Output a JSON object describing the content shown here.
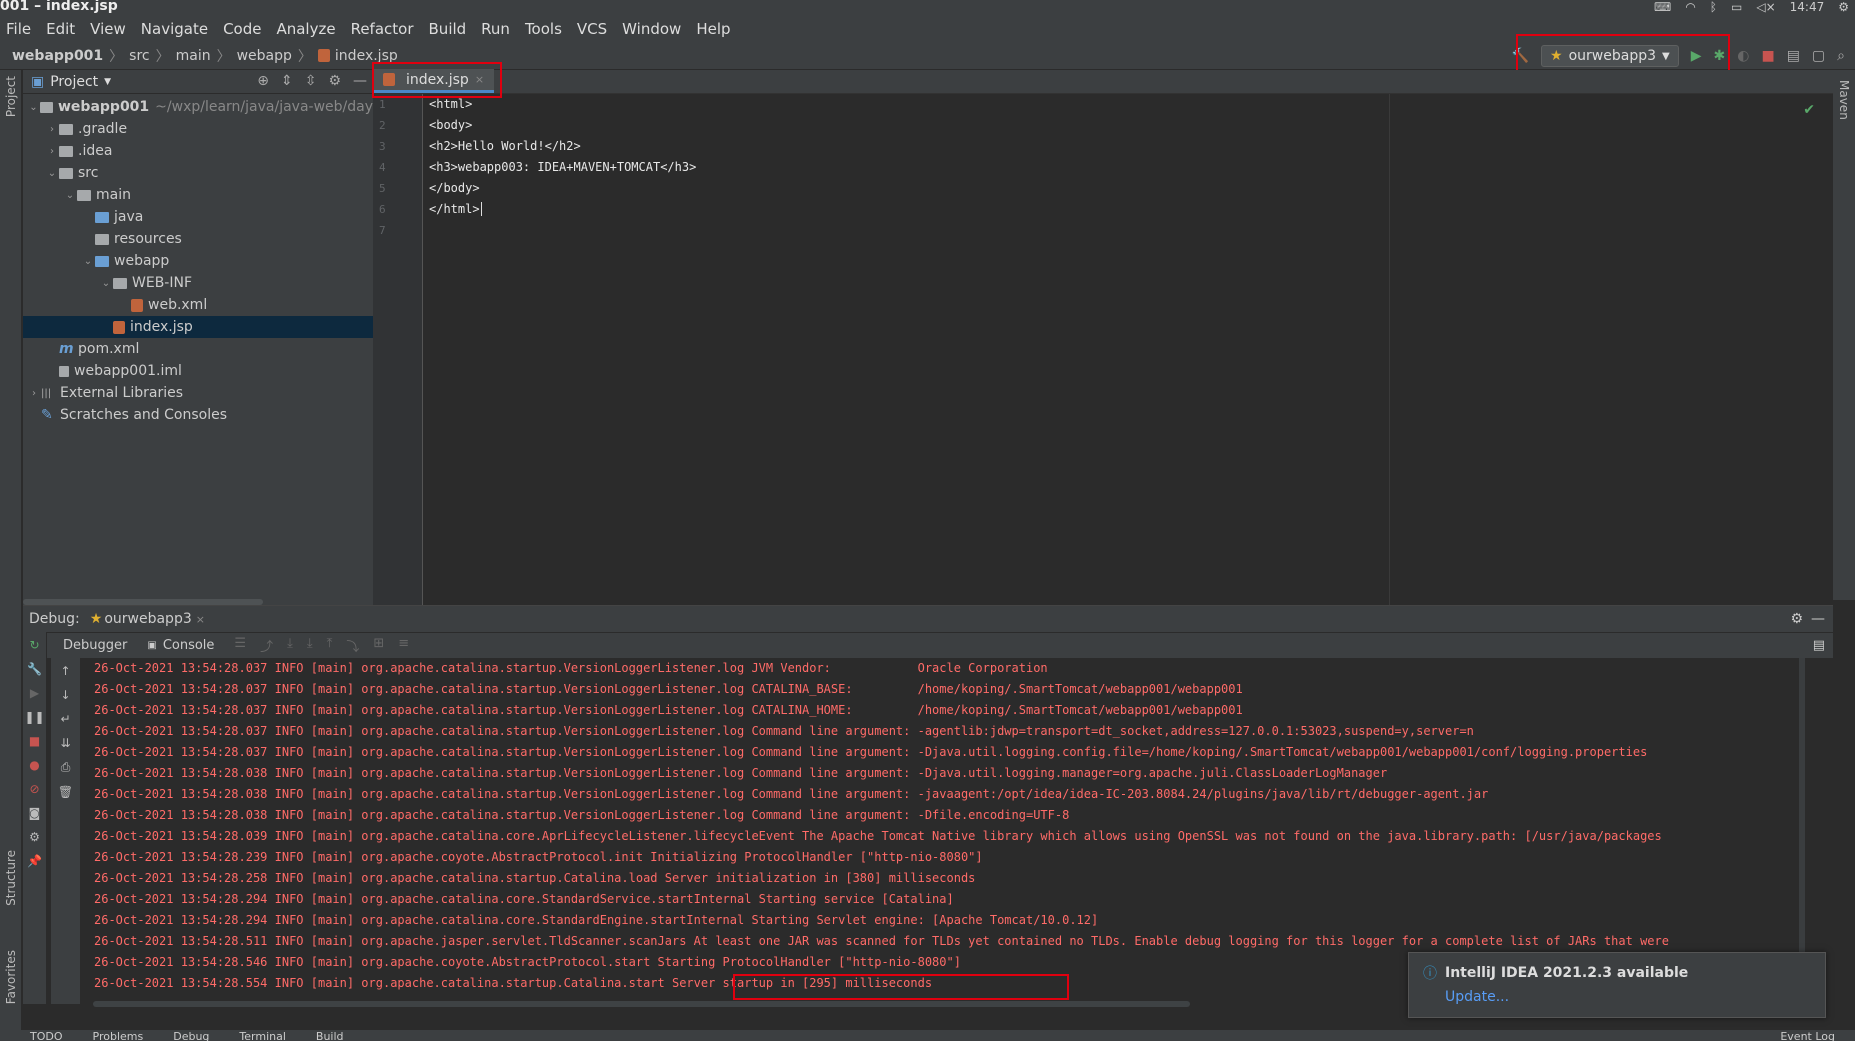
{
  "window": {
    "title": "001 – index.jsp",
    "time": "14:47"
  },
  "menu": [
    "File",
    "Edit",
    "View",
    "Navigate",
    "Code",
    "Analyze",
    "Refactor",
    "Build",
    "Run",
    "Tools",
    "VCS",
    "Window",
    "Help"
  ],
  "breadcrumb": [
    "webapp001",
    "src",
    "main",
    "webapp",
    "index.jsp"
  ],
  "run_config": {
    "label": "ourwebapp3"
  },
  "project_panel": {
    "title": "Project",
    "root_path": "~/wxp/learn/java/java-web/day",
    "tree": [
      {
        "label": "webapp001",
        "depth": 0,
        "arrow": "v",
        "icon": "folder"
      },
      {
        "label": ".gradle",
        "depth": 1,
        "arrow": ">",
        "icon": "folder"
      },
      {
        "label": ".idea",
        "depth": 1,
        "arrow": ">",
        "icon": "folder"
      },
      {
        "label": "src",
        "depth": 1,
        "arrow": "v",
        "icon": "folder"
      },
      {
        "label": "main",
        "depth": 2,
        "arrow": "v",
        "icon": "folder"
      },
      {
        "label": "java",
        "depth": 3,
        "arrow": "",
        "icon": "folder-blue"
      },
      {
        "label": "resources",
        "depth": 3,
        "arrow": "",
        "icon": "folder"
      },
      {
        "label": "webapp",
        "depth": 3,
        "arrow": "v",
        "icon": "folder-blue"
      },
      {
        "label": "WEB-INF",
        "depth": 4,
        "arrow": "v",
        "icon": "folder"
      },
      {
        "label": "web.xml",
        "depth": 5,
        "arrow": "",
        "icon": "xml"
      },
      {
        "label": "index.jsp",
        "depth": 4,
        "arrow": "",
        "icon": "jsp",
        "selected": true
      },
      {
        "label": "pom.xml",
        "depth": 1,
        "arrow": "",
        "icon": "maven"
      },
      {
        "label": "webapp001.iml",
        "depth": 1,
        "arrow": "",
        "icon": "file"
      },
      {
        "label": "External Libraries",
        "depth": 0,
        "arrow": ">",
        "icon": "libs"
      },
      {
        "label": "Scratches and Consoles",
        "depth": 0,
        "arrow": "",
        "icon": "scratch"
      }
    ]
  },
  "editor": {
    "tab": "index.jsp",
    "lines": [
      "<html>",
      "<body>",
      "<h2>Hello World!</h2>",
      "<h3>webapp003: IDEA+MAVEN+TOMCAT</h3>",
      "</body>",
      "</html>",
      ""
    ]
  },
  "debug": {
    "label": "Debug:",
    "session": "ourwebapp3",
    "tabs": [
      "Debugger",
      "Console"
    ],
    "log": [
      "26-Oct-2021 13:54:28.037 INFO [main] org.apache.catalina.startup.VersionLoggerListener.log JVM Vendor:            Oracle Corporation",
      "26-Oct-2021 13:54:28.037 INFO [main] org.apache.catalina.startup.VersionLoggerListener.log CATALINA_BASE:         /home/koping/.SmartTomcat/webapp001/webapp001",
      "26-Oct-2021 13:54:28.037 INFO [main] org.apache.catalina.startup.VersionLoggerListener.log CATALINA_HOME:         /home/koping/.SmartTomcat/webapp001/webapp001",
      "26-Oct-2021 13:54:28.037 INFO [main] org.apache.catalina.startup.VersionLoggerListener.log Command line argument: -agentlib:jdwp=transport=dt_socket,address=127.0.0.1:53023,suspend=y,server=n",
      "26-Oct-2021 13:54:28.037 INFO [main] org.apache.catalina.startup.VersionLoggerListener.log Command line argument: -Djava.util.logging.config.file=/home/koping/.SmartTomcat/webapp001/webapp001/conf/logging.properties",
      "26-Oct-2021 13:54:28.038 INFO [main] org.apache.catalina.startup.VersionLoggerListener.log Command line argument: -Djava.util.logging.manager=org.apache.juli.ClassLoaderLogManager",
      "26-Oct-2021 13:54:28.038 INFO [main] org.apache.catalina.startup.VersionLoggerListener.log Command line argument: -javaagent:/opt/idea/idea-IC-203.8084.24/plugins/java/lib/rt/debugger-agent.jar",
      "26-Oct-2021 13:54:28.038 INFO [main] org.apache.catalina.startup.VersionLoggerListener.log Command line argument: -Dfile.encoding=UTF-8",
      "26-Oct-2021 13:54:28.039 INFO [main] org.apache.catalina.core.AprLifecycleListener.lifecycleEvent The Apache Tomcat Native library which allows using OpenSSL was not found on the java.library.path: [/usr/java/packages",
      "26-Oct-2021 13:54:28.239 INFO [main] org.apache.coyote.AbstractProtocol.init Initializing ProtocolHandler [\"http-nio-8080\"]",
      "26-Oct-2021 13:54:28.258 INFO [main] org.apache.catalina.startup.Catalina.load Server initialization in [380] milliseconds",
      "26-Oct-2021 13:54:28.294 INFO [main] org.apache.catalina.core.StandardService.startInternal Starting service [Catalina]",
      "26-Oct-2021 13:54:28.294 INFO [main] org.apache.catalina.core.StandardEngine.startInternal Starting Servlet engine: [Apache Tomcat/10.0.12]",
      "26-Oct-2021 13:54:28.511 INFO [main] org.apache.jasper.servlet.TldScanner.scanJars At least one JAR was scanned for TLDs yet contained no TLDs. Enable debug logging for this logger for a complete list of JARs that were",
      "26-Oct-2021 13:54:28.546 INFO [main] org.apache.coyote.AbstractProtocol.start Starting ProtocolHandler [\"http-nio-8080\"]",
      "26-Oct-2021 13:54:28.554 INFO [main] org.apache.catalina.startup.Catalina.start Server startup in [295] milliseconds"
    ]
  },
  "notification": {
    "title": "IntelliJ IDEA 2021.2.3 available",
    "link": "Update..."
  },
  "bottom_tabs": [
    "TODO",
    "Problems",
    "Debug",
    "Terminal",
    "Build",
    "Event Log"
  ],
  "side_labels": {
    "project": "Project",
    "structure": "Structure",
    "favorites": "Favorites",
    "maven": "Maven"
  }
}
